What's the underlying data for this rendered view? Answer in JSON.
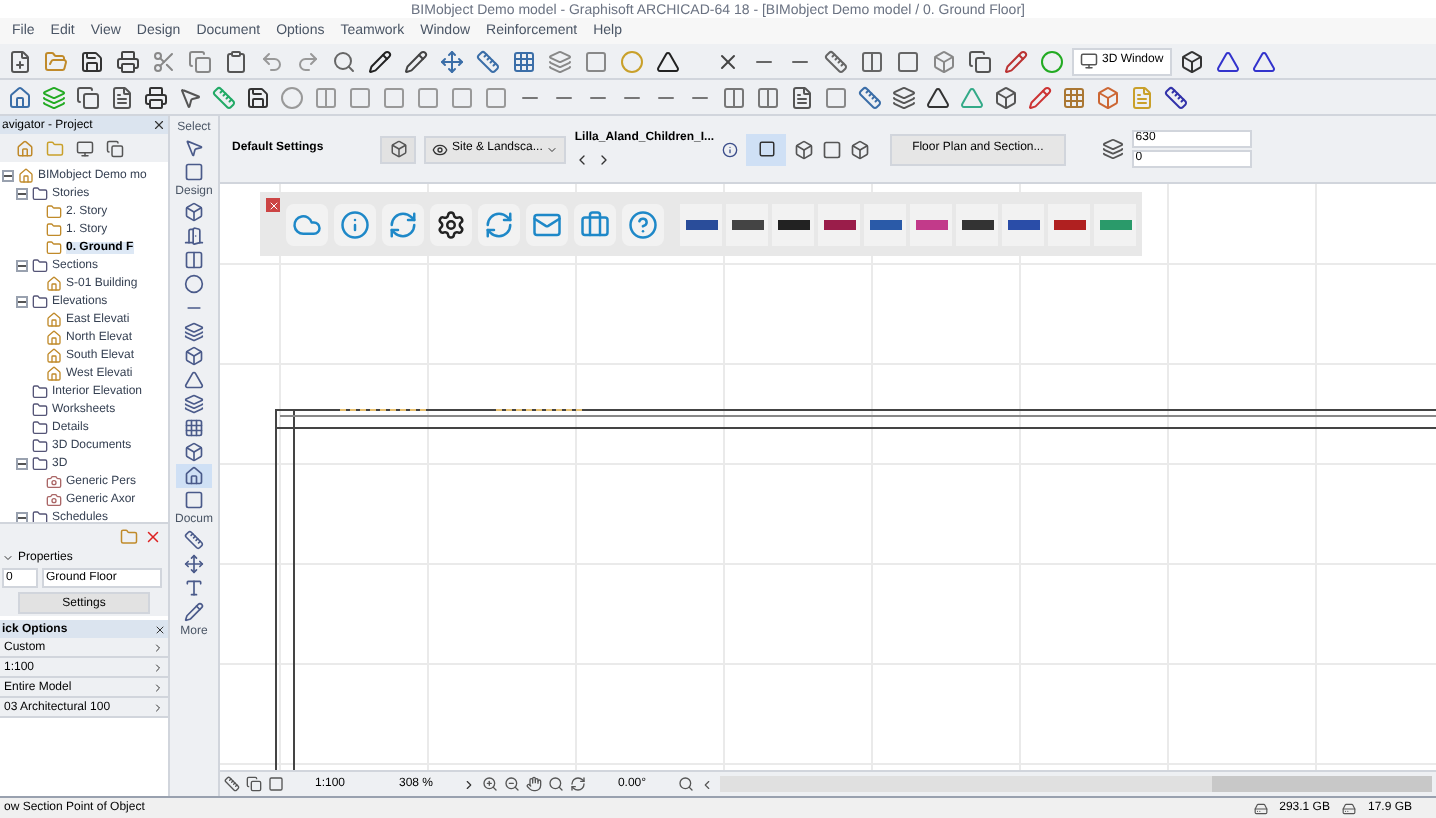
{
  "window": {
    "title": "BIMobject Demo model - Graphisoft ARCHICAD-64 18 - [BIMobject Demo model / 0. Ground Floor]"
  },
  "menu": [
    "File",
    "Edit",
    "View",
    "Design",
    "Document",
    "Options",
    "Teamwork",
    "Window",
    "Reinforcement",
    "Help"
  ],
  "toolbar": {
    "window_button": "3D Window"
  },
  "navigator": {
    "title": "avigator - Project",
    "tree": [
      {
        "label": "BIMobject Demo mo",
        "kind": "project",
        "selected": false,
        "expanded": true,
        "children": [
          {
            "label": "Stories",
            "kind": "folder",
            "selected": false,
            "expanded": true,
            "children": [
              {
                "label": "2. Story",
                "kind": "story",
                "selected": false
              },
              {
                "label": "1. Story",
                "kind": "story",
                "selected": false
              },
              {
                "label": "0. Ground F",
                "kind": "story",
                "selected": true
              }
            ]
          },
          {
            "label": "Sections",
            "kind": "folder",
            "selected": false,
            "expanded": true,
            "children": [
              {
                "label": "S-01 Building",
                "kind": "view",
                "selected": false
              }
            ]
          },
          {
            "label": "Elevations",
            "kind": "folder",
            "selected": false,
            "expanded": true,
            "children": [
              {
                "label": "East Elevati",
                "kind": "view",
                "selected": false
              },
              {
                "label": "North Elevat",
                "kind": "view",
                "selected": false
              },
              {
                "label": "South Elevat",
                "kind": "view",
                "selected": false
              },
              {
                "label": "West Elevati",
                "kind": "view",
                "selected": false
              }
            ]
          },
          {
            "label": "Interior Elevation",
            "kind": "folder",
            "selected": false
          },
          {
            "label": "Worksheets",
            "kind": "folder",
            "selected": false
          },
          {
            "label": "Details",
            "kind": "folder",
            "selected": false
          },
          {
            "label": "3D Documents",
            "kind": "folder",
            "selected": false
          },
          {
            "label": "3D",
            "kind": "folder",
            "selected": false,
            "expanded": true,
            "children": [
              {
                "label": "Generic Pers",
                "kind": "camera",
                "selected": false
              },
              {
                "label": "Generic Axor",
                "kind": "camera",
                "selected": false
              }
            ]
          },
          {
            "label": "Schedules",
            "kind": "folder",
            "selected": false,
            "expanded": true
          }
        ]
      }
    ]
  },
  "properties": {
    "title": "Properties",
    "id": "0",
    "name": "Ground Floor",
    "button": "Settings"
  },
  "quick_options": {
    "title": "ick Options",
    "rows": [
      "Custom",
      "1:100",
      "Entire Model",
      "03 Architectural 100"
    ]
  },
  "toolbox": {
    "sections": [
      "Select",
      "Design",
      "Docum",
      "More"
    ]
  },
  "info_box": {
    "settings": "Default Settings",
    "layer": "Site & Landsca...",
    "favorite": "Lilla_Aland_Children_I...",
    "view": "Floor Plan and Section...",
    "field_1": "630",
    "field_2": "0"
  },
  "status_bar": {
    "scale": "1:100",
    "zoom": "308 %",
    "angle": "0.00°"
  },
  "footer": {
    "prompt": "ow Section Point of Object",
    "disk_1": "293.1 GB",
    "disk_2": "17.9 GB"
  }
}
